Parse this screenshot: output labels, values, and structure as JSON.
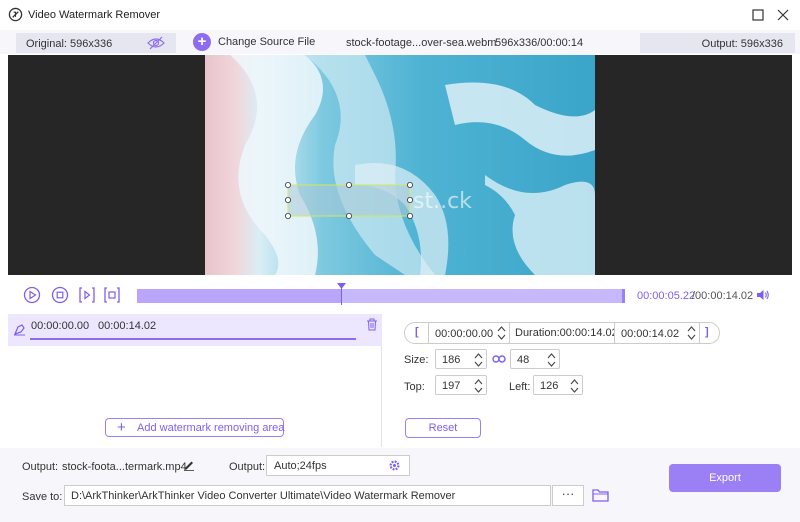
{
  "window": {
    "title": "Video Watermark Remover"
  },
  "info_bar": {
    "original": "Original: 596x336",
    "change_source": "Change Source File",
    "file_name": "stock-footage...over-sea.webm",
    "file_meta": "596x336/00:00:14",
    "output": "Output: 596x336"
  },
  "preview": {
    "watermark_text": "st..ck"
  },
  "playback": {
    "current_time": "00:00:05.22",
    "total_time": "/00:00:14.02",
    "progress_fraction": 0.42
  },
  "segment": {
    "start": "00:00:00.00",
    "end": "00:00:14.02"
  },
  "add_area_label": "Add watermark removing area",
  "range": {
    "open_bracket": "[",
    "start": "00:00:00.00",
    "duration": "Duration:00:00:14.02",
    "end": "00:00:14.02",
    "close_bracket": "]"
  },
  "size": {
    "label": "Size:",
    "width": "186",
    "height": "48"
  },
  "position": {
    "top_label": "Top:",
    "top": "197",
    "left_label": "Left:",
    "left": "126"
  },
  "reset_label": "Reset",
  "bottom": {
    "output_label": "Output:",
    "output_file": "stock-foota...termark.mp4",
    "format_label": "Output:",
    "format_value": "Auto;24fps",
    "save_label": "Save to:",
    "save_path": "D:\\ArkThinker\\ArkThinker Video Converter Ultimate\\Video Watermark Remover",
    "dots": "···",
    "export_label": "Export"
  },
  "colors": {
    "accent": "#8e6cf2",
    "accent_light": "#c7b8fb",
    "selected_row": "#ece7fe"
  }
}
